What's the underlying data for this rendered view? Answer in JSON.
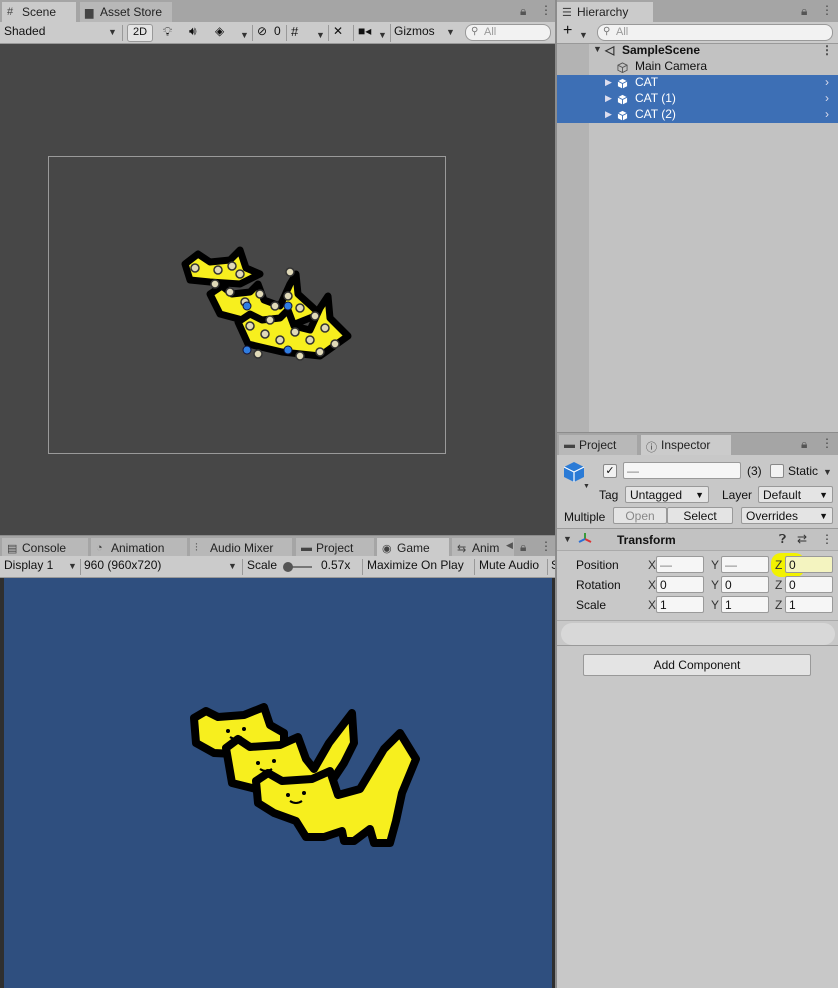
{
  "scene": {
    "tabs": [
      {
        "label": "Scene",
        "icon": "grid-icon"
      },
      {
        "label": "Asset Store",
        "icon": "store-icon"
      }
    ],
    "toolbar": {
      "shading_mode": "Shaded",
      "mode_2d": "2D",
      "hidden_count": "0",
      "gizmos": "Gizmos",
      "search_placeholder": "All"
    }
  },
  "hierarchy": {
    "tab": "Hierarchy",
    "search_placeholder": "All",
    "scene_name": "SampleScene",
    "items": [
      {
        "label": "Main Camera",
        "selected": false
      },
      {
        "label": "CAT",
        "selected": true
      },
      {
        "label": "CAT (1)",
        "selected": true
      },
      {
        "label": "CAT (2)",
        "selected": true
      }
    ]
  },
  "bottom_tabs": [
    {
      "label": "Console",
      "icon": "console-icon"
    },
    {
      "label": "Animation",
      "icon": "animation-icon"
    },
    {
      "label": "Audio Mixer",
      "icon": "audio-mixer-icon"
    },
    {
      "label": "Project",
      "icon": "folder-icon"
    },
    {
      "label": "Game",
      "icon": "gamepad-icon"
    },
    {
      "label": "Anim",
      "icon": "animator-icon"
    }
  ],
  "game": {
    "display": "Display 1",
    "resolution": "960 (960x720)",
    "scale_label": "Scale",
    "scale_value": "0.57x",
    "maximize": "Maximize On Play",
    "mute": "Mute Audio",
    "overflow": "S",
    "background": "#2f4f7f"
  },
  "inspector": {
    "tabs": [
      {
        "label": "Project",
        "icon": "folder-icon"
      },
      {
        "label": "Inspector",
        "icon": "info-icon"
      }
    ],
    "object_name": "—",
    "object_count": "(3)",
    "static_label": "Static",
    "tag_label": "Tag",
    "tag_value": "Untagged",
    "layer_label": "Layer",
    "layer_value": "Default",
    "multiple_label": "Multiple",
    "open_btn": "Open",
    "select_btn": "Select",
    "overrides": "Overrides",
    "component_title": "Transform",
    "axes": {
      "x": "X",
      "y": "Y",
      "z": "Z"
    },
    "rows": [
      {
        "label": "Position",
        "x": "—",
        "y": "—",
        "z": "0"
      },
      {
        "label": "Rotation",
        "x": "0",
        "y": "0",
        "z": "0"
      },
      {
        "label": "Scale",
        "x": "1",
        "y": "1",
        "z": "1"
      }
    ],
    "add_component": "Add Component"
  },
  "colors": {
    "selection": "#3d6fb5",
    "highlight": "#f2f200",
    "cat_fill": "#f7ef1e",
    "scene_bg": "#474747"
  }
}
